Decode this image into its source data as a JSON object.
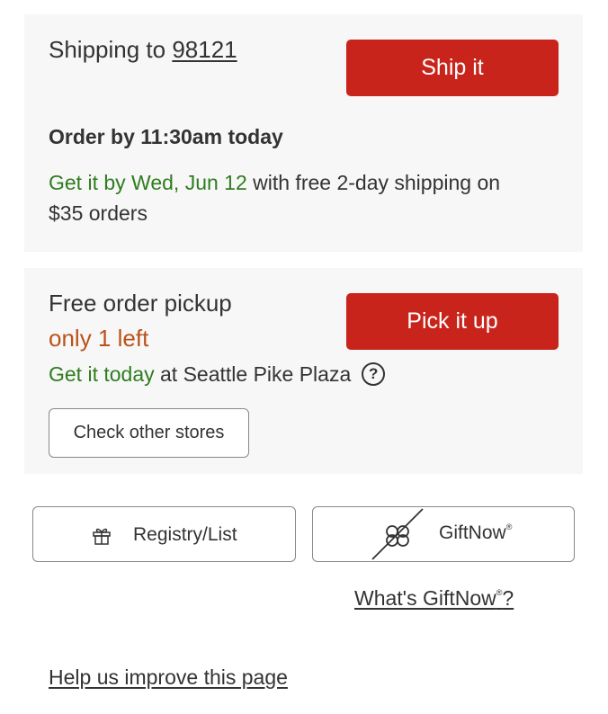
{
  "shipping": {
    "title_prefix": "Shipping to",
    "zip": "98121",
    "button": "Ship it",
    "order_by": "Order by 11:30am today",
    "arrival": "Get it by Wed, Jun 12",
    "arrival_suffix": " with free 2-day shipping on",
    "threshold": "$35 orders"
  },
  "pickup": {
    "title": "Free order pickup",
    "stock": "only 1 left",
    "availability": "Get it today",
    "store": " at Seattle Pike Plaza",
    "help_glyph": "?",
    "button": "Pick it up",
    "check_stores": "Check other stores"
  },
  "actions": {
    "registry": "Registry/List",
    "giftnow": "GiftNow",
    "reg_mark": "®",
    "whats_giftnow": "What's GiftNow",
    "question": "?"
  },
  "footer": {
    "help_link": "Help us improve this page"
  },
  "colors": {
    "primary_button": "#c9241c",
    "availability_green": "#2e7d1e",
    "stock_orange": "#b9531b",
    "card_background": "#f7f7f7"
  },
  "icons": {
    "registry": "gift-icon",
    "giftnow": "giftnow-ribbon-icon",
    "help": "help-circle-icon"
  }
}
